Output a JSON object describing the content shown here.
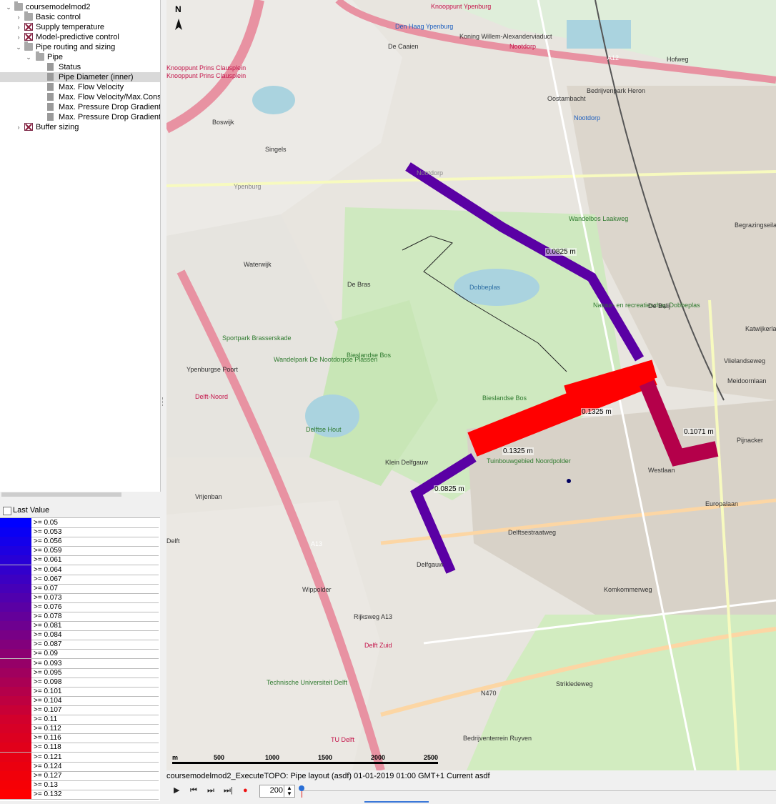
{
  "tree": {
    "root": "coursemodelmod2",
    "items": [
      {
        "label": "Basic control",
        "depth": 1,
        "icon": "folder-icon",
        "expand": "collapsed"
      },
      {
        "label": "Supply temperature",
        "depth": 1,
        "icon": "crossed-module-icon",
        "expand": "collapsed"
      },
      {
        "label": "Model-predictive control",
        "depth": 1,
        "icon": "crossed-module-icon",
        "expand": "collapsed"
      },
      {
        "label": "Pipe routing and sizing",
        "depth": 1,
        "icon": "folder-icon",
        "expand": "expanded"
      },
      {
        "label": "Pipe",
        "depth": 2,
        "icon": "folder-icon",
        "expand": "expanded"
      },
      {
        "label": "Status",
        "depth": 3,
        "icon": "document-icon",
        "expand": "none"
      },
      {
        "label": "Pipe Diameter (inner)",
        "depth": 3,
        "icon": "document-icon",
        "expand": "none",
        "selected": true
      },
      {
        "label": "Max. Flow Velocity",
        "depth": 3,
        "icon": "document-icon",
        "expand": "none"
      },
      {
        "label": "Max. Flow Velocity/Max.Const",
        "depth": 3,
        "icon": "document-icon",
        "expand": "none"
      },
      {
        "label": "Max. Pressure Drop Gradient",
        "depth": 3,
        "icon": "document-icon",
        "expand": "none"
      },
      {
        "label": "Max. Pressure Drop Gradient/M",
        "depth": 3,
        "icon": "document-icon",
        "expand": "none"
      },
      {
        "label": "Buffer sizing",
        "depth": 1,
        "icon": "crossed-module-icon",
        "expand": "collapsed"
      }
    ]
  },
  "legend": {
    "title": "Last Value",
    "rows": [
      {
        "label": ">= 0.05",
        "color": "#0000ff"
      },
      {
        "label": ">= 0.053",
        "color": "#0a00f4"
      },
      {
        "label": ">= 0.056",
        "color": "#1400ea"
      },
      {
        "label": ">= 0.059",
        "color": "#1e00e0"
      },
      {
        "label": ">= 0.061",
        "color": "#2800d6"
      },
      {
        "label": ">= 0.064",
        "color": "#3200cc"
      },
      {
        "label": ">= 0.067",
        "color": "#3c00c2"
      },
      {
        "label": ">= 0.07",
        "color": "#4600b8"
      },
      {
        "label": ">= 0.073",
        "color": "#5000ae"
      },
      {
        "label": ">= 0.076",
        "color": "#5a00a4"
      },
      {
        "label": ">= 0.078",
        "color": "#64009a"
      },
      {
        "label": ">= 0.081",
        "color": "#6e0090"
      },
      {
        "label": ">= 0.084",
        "color": "#780086"
      },
      {
        "label": ">= 0.087",
        "color": "#82007c"
      },
      {
        "label": ">= 0.09",
        "color": "#8c0072"
      },
      {
        "label": ">= 0.093",
        "color": "#960068"
      },
      {
        "label": ">= 0.095",
        "color": "#a0005e"
      },
      {
        "label": ">= 0.098",
        "color": "#aa0054"
      },
      {
        "label": ">= 0.101",
        "color": "#b4004a"
      },
      {
        "label": ">= 0.104",
        "color": "#be0040"
      },
      {
        "label": ">= 0.107",
        "color": "#c80036"
      },
      {
        "label": ">= 0.11",
        "color": "#d2002c"
      },
      {
        "label": ">= 0.112",
        "color": "#d70026"
      },
      {
        "label": ">= 0.116",
        "color": "#dc0020"
      },
      {
        "label": ">= 0.118",
        "color": "#e1001a"
      },
      {
        "label": ">= 0.121",
        "color": "#e60014"
      },
      {
        "label": ">= 0.124",
        "color": "#eb000f"
      },
      {
        "label": ">= 0.127",
        "color": "#f0000a"
      },
      {
        "label": ">= 0.13",
        "color": "#f60005"
      },
      {
        "label": ">= 0.132",
        "color": "#ff0000"
      }
    ]
  },
  "map": {
    "north_label": "N",
    "pipes": [
      {
        "label": "0.0825 m",
        "color": "#5a00a4"
      },
      {
        "label": "0.1325 m",
        "color": "#ff0000"
      },
      {
        "label": "0.1325 m",
        "color": "#ff0000"
      },
      {
        "label": "0.1071 m",
        "color": "#b4004a"
      },
      {
        "label": "0.0825 m",
        "color": "#5a00a4"
      }
    ],
    "places": [
      {
        "text": "Den Haag Ypenburg",
        "color": "#1d5fbf"
      },
      {
        "text": "Knooppunt Ypenburg",
        "color": "#c4144a"
      },
      {
        "text": "Knooppunt Prins Clausplein",
        "color": "#c4144a"
      },
      {
        "text": "Knooppunt Prins Clausplein",
        "color": "#c4144a"
      },
      {
        "text": "De Caaien",
        "color": "#333333"
      },
      {
        "text": "Koning Willem-Alexanderviaduct",
        "color": "#333333"
      },
      {
        "text": "Nootdorp",
        "color": "#c4144a"
      },
      {
        "text": "Nootdorp",
        "color": "#1d5fbf"
      },
      {
        "text": "A12",
        "color": "#ffffff"
      },
      {
        "text": "Hofweg",
        "color": "#333333"
      },
      {
        "text": "Oostambacht",
        "color": "#333333"
      },
      {
        "text": "Bedrijvenpark Heron",
        "color": "#333333"
      },
      {
        "text": "Boswijk",
        "color": "#333333"
      },
      {
        "text": "Singels",
        "color": "#333333"
      },
      {
        "text": "Ypenburg",
        "color": "#888888"
      },
      {
        "text": "Nootdorp",
        "color": "#888888"
      },
      {
        "text": "Wandelbos Laakweg",
        "color": "#2e7a2e"
      },
      {
        "text": "Waterwijk",
        "color": "#333333"
      },
      {
        "text": "De Bras",
        "color": "#333333"
      },
      {
        "text": "Dobbeplas",
        "color": "#2c6da3"
      },
      {
        "text": "Natuur- en recreatieschap Dobbeplas",
        "color": "#2e7a2e"
      },
      {
        "text": "Sportpark Brasserskade",
        "color": "#2e7a2e"
      },
      {
        "text": "Wandelpark De Nootdorpse Plassen",
        "color": "#2e7a2e"
      },
      {
        "text": "Bieslandse Bos",
        "color": "#2e7a2e"
      },
      {
        "text": "Bieslandse Bos",
        "color": "#2e7a2e"
      },
      {
        "text": "Delftse Hout",
        "color": "#2e7a2e"
      },
      {
        "text": "Klein Delfgauw",
        "color": "#333333"
      },
      {
        "text": "Tuinbouwgebied Noordpolder",
        "color": "#2e7a2e"
      },
      {
        "text": "Pijnacker",
        "color": "#333333"
      },
      {
        "text": "Westlaan",
        "color": "#333333"
      },
      {
        "text": "Vrijenban",
        "color": "#333333"
      },
      {
        "text": "Delft",
        "color": "#333333"
      },
      {
        "text": "Delfgauw",
        "color": "#333333"
      },
      {
        "text": "Wippolder",
        "color": "#333333"
      },
      {
        "text": "Technische Universiteit Delft",
        "color": "#2e7a2e"
      },
      {
        "text": "A13",
        "color": "#ffffff"
      },
      {
        "text": "Strikledeweg",
        "color": "#333333"
      },
      {
        "text": "N470",
        "color": "#333333"
      },
      {
        "text": "Bedrijventerrein Ruyven",
        "color": "#333333"
      },
      {
        "text": "TU Delft",
        "color": "#c4144a"
      },
      {
        "text": "Delft Zuid",
        "color": "#c4144a"
      },
      {
        "text": "Delft-Noord",
        "color": "#c4144a"
      },
      {
        "text": "Ypenburgse Poort",
        "color": "#333333"
      },
      {
        "text": "Delftsestraatweg",
        "color": "#333333"
      },
      {
        "text": "Europalaan",
        "color": "#333333"
      },
      {
        "text": "Komkommerweg",
        "color": "#333333"
      },
      {
        "text": "Rijksweg A13",
        "color": "#333333"
      },
      {
        "text": "Katwijkerlaan",
        "color": "#333333"
      },
      {
        "text": "Vlielandseweg",
        "color": "#333333"
      },
      {
        "text": "Meidoornlaan",
        "color": "#333333"
      },
      {
        "text": "Begrazingseiland",
        "color": "#333333"
      },
      {
        "text": "De Balij",
        "color": "#333333"
      }
    ],
    "scale": {
      "unit": "m",
      "ticks": [
        "500",
        "1000",
        "1500",
        "2000",
        "2500"
      ]
    }
  },
  "status": "coursemodelmod2_ExecuteTOPO: Pipe layout (asdf) 01-01-2019 01:00 GMT+1 Current asdf",
  "controls": {
    "play": "▶",
    "step_back": "⏮",
    "step_forward": "⏭",
    "play_end": "⏭|",
    "record": "●",
    "speed": "200"
  }
}
